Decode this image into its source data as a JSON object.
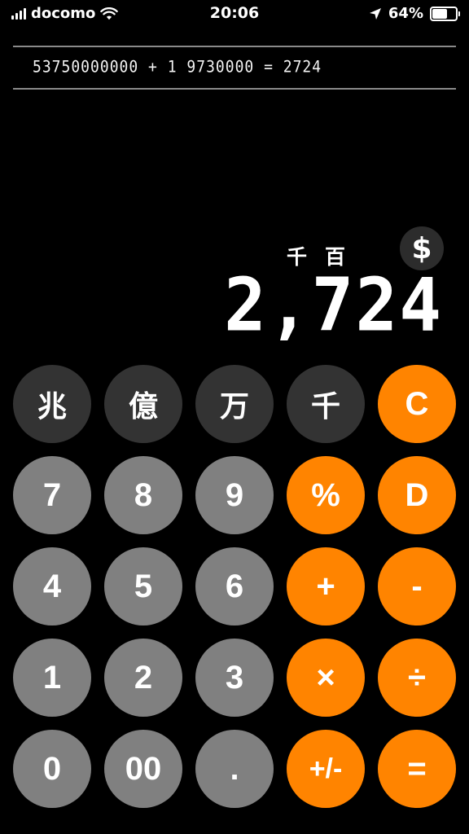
{
  "status_bar": {
    "carrier": "docomo",
    "time": "20:06",
    "battery_percent": "64%",
    "battery_level": 0.64,
    "icons": [
      "signal-icon",
      "wifi-icon",
      "location-arrow-icon",
      "battery-icon"
    ]
  },
  "history": {
    "text": "53750000000 + 1 9730000 = 2724"
  },
  "display": {
    "unit_labels": [
      "千",
      "百"
    ],
    "currency_button": "$",
    "value": "2,724"
  },
  "keypad": {
    "rows": [
      [
        {
          "label": "兆",
          "type": "dark"
        },
        {
          "label": "億",
          "type": "dark"
        },
        {
          "label": "万",
          "type": "dark"
        },
        {
          "label": "千",
          "type": "dark"
        },
        {
          "label": "C",
          "type": "orange"
        }
      ],
      [
        {
          "label": "7",
          "type": "gray"
        },
        {
          "label": "8",
          "type": "gray"
        },
        {
          "label": "9",
          "type": "gray"
        },
        {
          "label": "%",
          "type": "orange"
        },
        {
          "label": "D",
          "type": "orange"
        }
      ],
      [
        {
          "label": "4",
          "type": "gray"
        },
        {
          "label": "5",
          "type": "gray"
        },
        {
          "label": "6",
          "type": "gray"
        },
        {
          "label": "+",
          "type": "orange"
        },
        {
          "label": "-",
          "type": "orange"
        }
      ],
      [
        {
          "label": "1",
          "type": "gray"
        },
        {
          "label": "2",
          "type": "gray"
        },
        {
          "label": "3",
          "type": "gray"
        },
        {
          "label": "×",
          "type": "orange"
        },
        {
          "label": "÷",
          "type": "orange"
        }
      ],
      [
        {
          "label": "0",
          "type": "gray"
        },
        {
          "label": "00",
          "type": "gray"
        },
        {
          "label": ".",
          "type": "gray"
        },
        {
          "label": "+/-",
          "type": "orange"
        },
        {
          "label": "=",
          "type": "orange"
        }
      ]
    ]
  },
  "colors": {
    "background": "#000000",
    "dark_key": "#333333",
    "gray_key": "#808080",
    "orange_key": "#ff8400"
  }
}
